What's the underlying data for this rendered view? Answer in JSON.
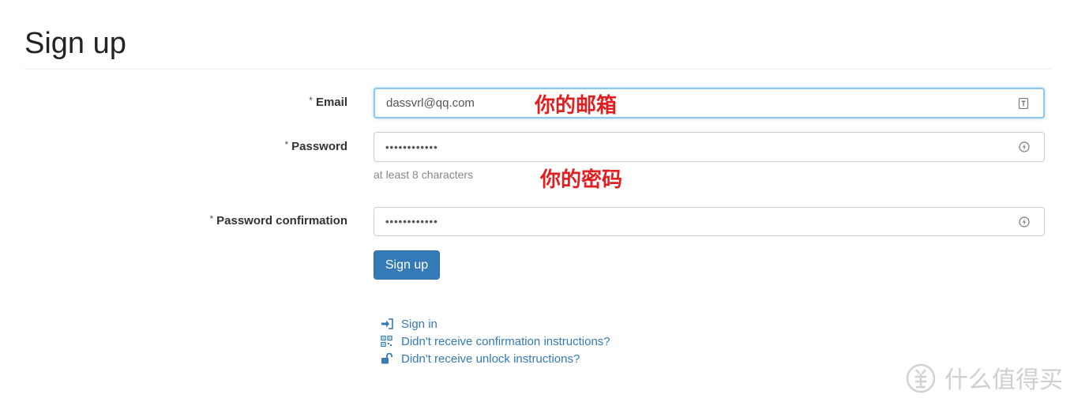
{
  "header": {
    "title": "Sign up"
  },
  "form": {
    "email": {
      "label": "Email",
      "required_marker": "*",
      "value": "dassvrl@qq.com",
      "icon": "contact-card-icon"
    },
    "password": {
      "label": "Password",
      "required_marker": "*",
      "value": "••••••••••••",
      "help": "at least 8 characters",
      "icon": "key-icon"
    },
    "password_confirmation": {
      "label": "Password confirmation",
      "required_marker": "*",
      "value": "••••••••••••",
      "icon": "key-icon"
    },
    "submit_label": "Sign up"
  },
  "annotations": {
    "email_note": "你的邮箱",
    "password_note": "你的密码"
  },
  "links": [
    {
      "label": "Sign in",
      "icon": "sign-in-icon"
    },
    {
      "label": "Didn't receive confirmation instructions?",
      "icon": "qrcode-icon"
    },
    {
      "label": "Didn't receive unlock instructions?",
      "icon": "unlock-icon"
    }
  ],
  "watermark": {
    "text": "什么值得买",
    "icon": "zhi-logo-icon"
  },
  "colors": {
    "primary": "#337ab7",
    "annotation": "#e02020",
    "focus_border": "#8ec5ec"
  }
}
